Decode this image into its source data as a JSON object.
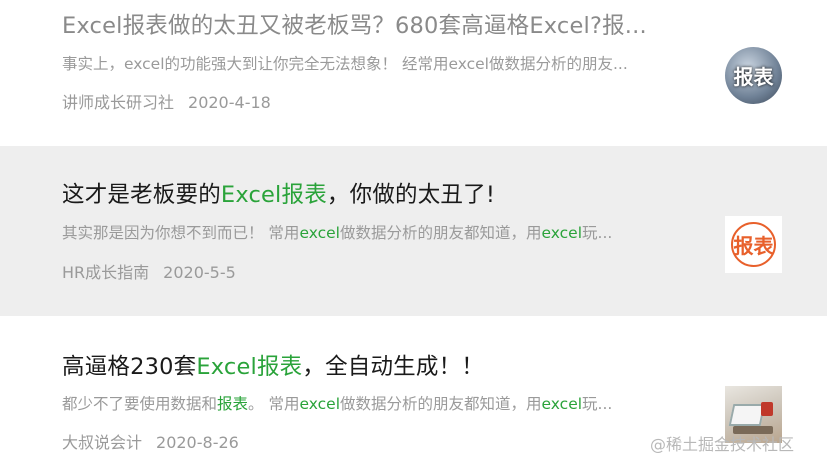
{
  "articles": [
    {
      "title": "Excel报表做的太丑又被老板骂？680套高逼格Excel?报...",
      "desc": "事实上，excel的功能强大到让你完全无法想象！ 经常用excel做数据分析的朋友...",
      "source": "讲师成长研习社",
      "date": "2020-4-18",
      "thumb_text": "报表"
    },
    {
      "title_pre": "这才是老板要的",
      "title_hl": "Excel报表",
      "title_post": "，你做的太丑了!",
      "desc_pre": "其实那是因为你想不到而已！ 常用",
      "desc_hl1": "excel",
      "desc_mid": "做数据分析的朋友都知道，用",
      "desc_hl2": "excel",
      "desc_post": "玩...",
      "source": "HR成长指南",
      "date": "2020-5-5",
      "thumb_text": "报表"
    },
    {
      "title_pre": "高逼格230套",
      "title_hl": "Excel报表",
      "title_post": "，全自动生成！！",
      "desc_pre": "都少不了要使用数据和",
      "desc_hl0": "报表",
      "desc_mid0": "。 常用",
      "desc_hl1": "excel",
      "desc_mid": "做数据分析的朋友都知道，用",
      "desc_hl2": "excel",
      "desc_post": "玩...",
      "source": "大叔说会计",
      "date": "2020-8-26"
    }
  ],
  "watermark": "@稀土掘金技术社区",
  "colors": {
    "highlight": "#2aa33a",
    "muted": "#9a9a9a",
    "selected_bg": "#eeeeee"
  }
}
